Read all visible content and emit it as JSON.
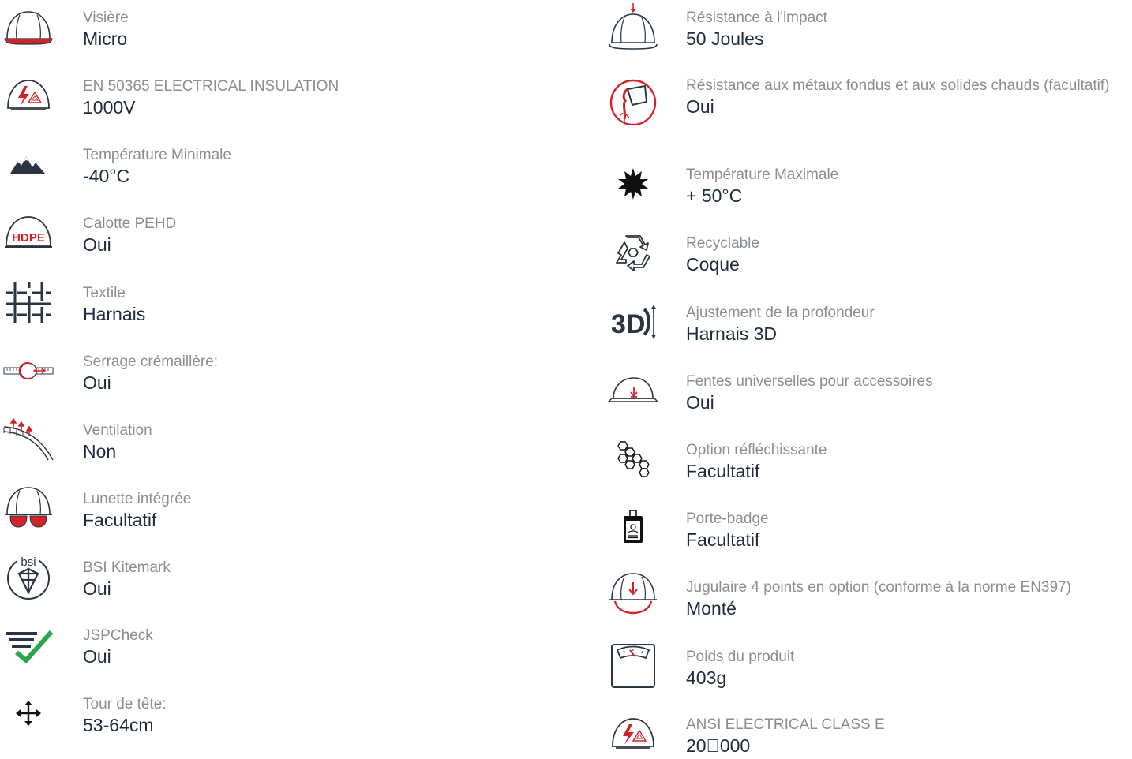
{
  "colors": {
    "text_label": "#8a8d91",
    "text_value": "#1f2a3d",
    "accent_red": "#d3232a",
    "icon_dark": "#2b3442",
    "check_green": "#2ea44f"
  },
  "left": [
    {
      "icon": "helmet-visor-icon",
      "label": "Visière",
      "value": "Micro"
    },
    {
      "icon": "electrical-insulation-icon",
      "label": "EN 50365 ELECTRICAL INSULATION",
      "value": "1000V"
    },
    {
      "icon": "mountain-icon",
      "label": "Température Minimale",
      "value": "-40°C"
    },
    {
      "icon": "hdpe-helmet-icon",
      "label": "Calotte PEHD",
      "value": "Oui",
      "icon_text": "HDPE"
    },
    {
      "icon": "textile-grid-icon",
      "label": "Textile",
      "value": "Harnais"
    },
    {
      "icon": "ratchet-icon",
      "label": "Serrage crémaillère:",
      "value": "Oui"
    },
    {
      "icon": "ventilation-icon",
      "label": "Ventilation",
      "value": "Non"
    },
    {
      "icon": "helmet-goggles-icon",
      "label": "Lunette intégrée",
      "value": "Facultatif"
    },
    {
      "icon": "bsi-kitemark-icon",
      "label": "BSI Kitemark",
      "value": "Oui",
      "icon_text": "bsi"
    },
    {
      "icon": "jspcheck-icon",
      "label": "JSPCheck",
      "value": "Oui"
    },
    {
      "icon": "move-arrows-icon",
      "label": "Tour de tête:",
      "value": "53-64cm"
    }
  ],
  "right": [
    {
      "icon": "impact-helmet-icon",
      "label": "Résistance à l'impact",
      "value": "50 Joules"
    },
    {
      "icon": "molten-metal-icon",
      "label": "Résistance aux métaux fondus et aux solides chauds (facultatif)",
      "value": "Oui"
    },
    {
      "icon": "sun-icon",
      "label": "Température Maximale",
      "value": "+ 50°C"
    },
    {
      "icon": "recycle-icon",
      "label": "Recyclable",
      "value": "Coque"
    },
    {
      "icon": "3d-depth-icon",
      "label": "Ajustement de la profondeur",
      "value": "Harnais 3D",
      "icon_text": "3D"
    },
    {
      "icon": "accessory-slot-icon",
      "label": "Fentes universelles pour accessoires",
      "value": "Oui"
    },
    {
      "icon": "honeycomb-icon",
      "label": "Option réfléchissante",
      "value": "Facultatif"
    },
    {
      "icon": "badge-holder-icon",
      "label": "Porte-badge",
      "value": "Facultatif"
    },
    {
      "icon": "chinstrap-helmet-icon",
      "label": "Jugulaire 4 points en option (conforme à la norme EN397)",
      "value": "Monté"
    },
    {
      "icon": "weight-scale-icon",
      "label": "Poids du produit",
      "value": "403g"
    },
    {
      "icon": "electrical-insulation-icon",
      "label": "ANSI ELECTRICAL CLASS E",
      "value": "20\u0000000"
    }
  ]
}
